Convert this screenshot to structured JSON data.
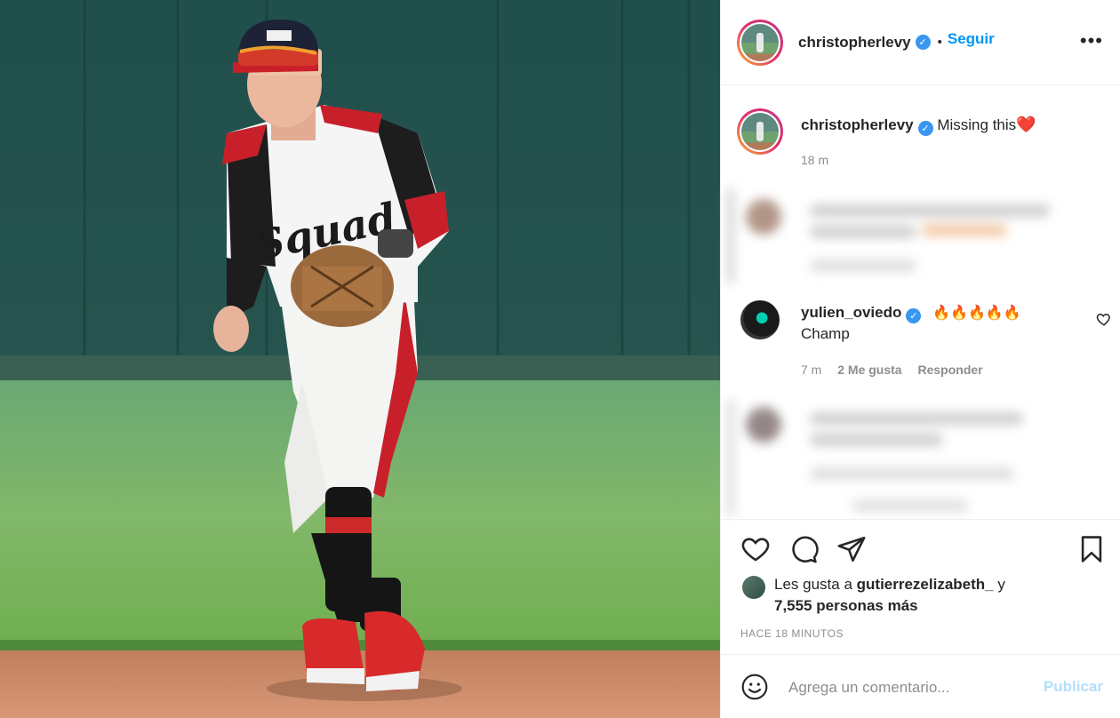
{
  "post": {
    "username": "christopherlevy",
    "verified_icon": "verified-badge-icon",
    "separator": "•",
    "follow_label": "Seguir",
    "more_icon": "more-options-icon",
    "more_label": "•••"
  },
  "caption": {
    "username": "christopherlevy",
    "text": "Missing this",
    "emoji": "❤️",
    "time": "18 m"
  },
  "comment": {
    "username": "yulien_oviedo",
    "emojis": "🔥🔥🔥🔥🔥",
    "text": "Champ",
    "time": "7 m",
    "likes": "2 Me gusta",
    "reply_label": "Responder"
  },
  "likes": {
    "prefix": "Les gusta a",
    "user": "gutierrezelizabeth_",
    "conjunction": "y",
    "others": "7,555 personas más"
  },
  "timestamp": "HACE 18 MINUTOS",
  "add_comment": {
    "placeholder": "Agrega un comentario...",
    "post_label": "Publicar"
  },
  "colors": {
    "accent": "#0095f6",
    "verified": "#3897f0",
    "post_disabled": "#b2dffc",
    "muted": "#8e8e8e"
  }
}
